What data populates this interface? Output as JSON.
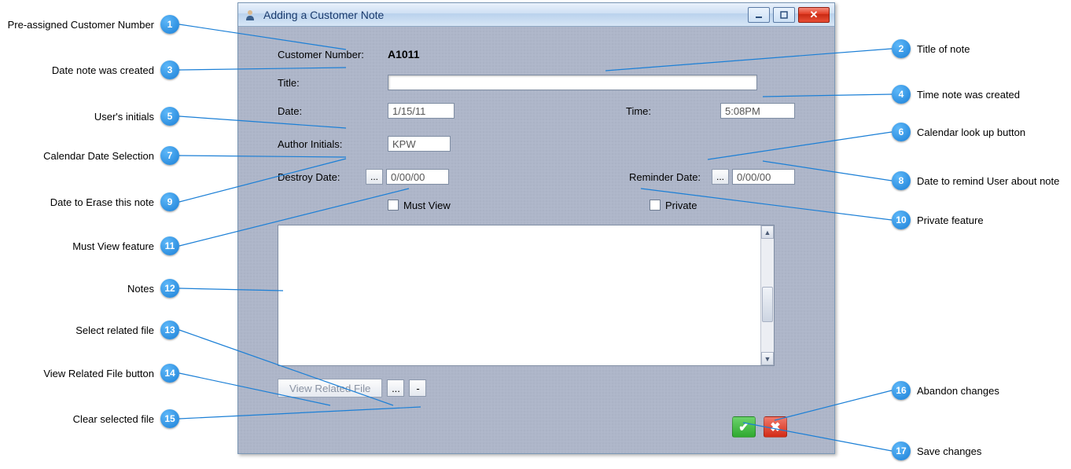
{
  "window": {
    "title": "Adding a Customer Note"
  },
  "form": {
    "customer_number_label": "Customer Number:",
    "customer_number_value": "A1011",
    "title_label": "Title:",
    "title_value": "",
    "date_label": "Date:",
    "date_value": "1/15/11",
    "time_label": "Time:",
    "time_value": "5:08PM",
    "author_label": "Author Initials:",
    "author_value": "KPW",
    "destroy_label": "Destroy Date:",
    "destroy_value": "0/00/00",
    "reminder_label": "Reminder Date:",
    "reminder_value": "0/00/00",
    "must_view_label": "Must View",
    "private_label": "Private",
    "notes_value": "",
    "view_related_label": "View Related File",
    "ellipsis": "...",
    "dash": "-"
  },
  "callouts": {
    "c1": {
      "num": "1",
      "text": "Pre-assigned Customer Number"
    },
    "c2": {
      "num": "2",
      "text": "Title of note"
    },
    "c3": {
      "num": "3",
      "text": "Date note was created"
    },
    "c4": {
      "num": "4",
      "text": "Time note was created"
    },
    "c5": {
      "num": "5",
      "text": "User's initials"
    },
    "c6": {
      "num": "6",
      "text": "Calendar look up button"
    },
    "c7": {
      "num": "7",
      "text": "Calendar Date Selection"
    },
    "c8": {
      "num": "8",
      "text": "Date to remind User about note"
    },
    "c9": {
      "num": "9",
      "text": "Date to Erase this note"
    },
    "c10": {
      "num": "10",
      "text": "Private feature"
    },
    "c11": {
      "num": "11",
      "text": "Must View feature"
    },
    "c12": {
      "num": "12",
      "text": "Notes"
    },
    "c13": {
      "num": "13",
      "text": "Select related file"
    },
    "c14": {
      "num": "14",
      "text": "View Related File button"
    },
    "c15": {
      "num": "15",
      "text": "Clear selected file"
    },
    "c16": {
      "num": "16",
      "text": "Abandon changes"
    },
    "c17": {
      "num": "17",
      "text": "Save changes"
    }
  }
}
